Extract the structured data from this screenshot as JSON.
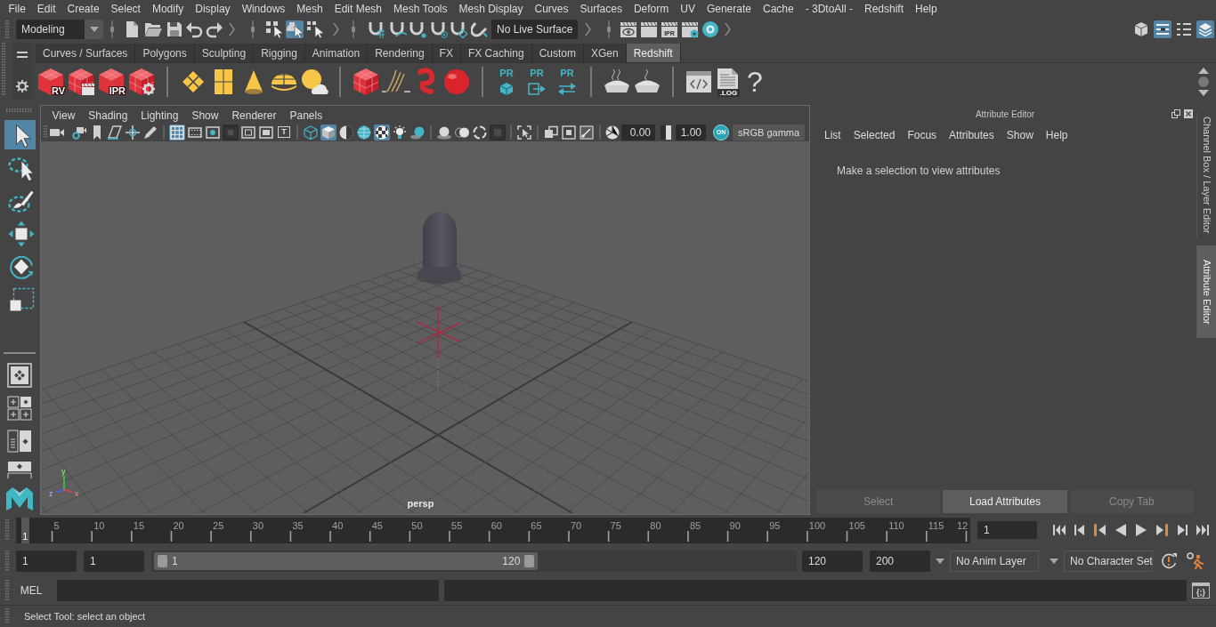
{
  "menu_bar": [
    "File",
    "Edit",
    "Create",
    "Select",
    "Modify",
    "Display",
    "Windows",
    "Mesh",
    "Edit Mesh",
    "Mesh Tools",
    "Mesh Display",
    "Curves",
    "Surfaces",
    "Deform",
    "UV",
    "Generate",
    "Cache",
    "- 3DtoAll -",
    "Redshift",
    "Help"
  ],
  "status_line": {
    "menu_set": "Modeling",
    "selection_modes": [
      {
        "selected": false
      },
      {
        "selected": true
      },
      {
        "selected": false
      }
    ],
    "live_surface": "No Live Surface",
    "ipr_label": "IPR",
    "panel_toggles": [
      {
        "on": false
      },
      {
        "on": true
      },
      {
        "on": false
      },
      {
        "on": true
      }
    ]
  },
  "shelf": {
    "tabs": [
      {
        "label": "Curves / Surfaces",
        "selected": false
      },
      {
        "label": "Polygons",
        "selected": false
      },
      {
        "label": "Sculpting",
        "selected": false
      },
      {
        "label": "Rigging",
        "selected": false
      },
      {
        "label": "Animation",
        "selected": false
      },
      {
        "label": "Rendering",
        "selected": false
      },
      {
        "label": "FX",
        "selected": false
      },
      {
        "label": "FX Caching",
        "selected": false
      },
      {
        "label": "Custom",
        "selected": false
      },
      {
        "label": "XGen",
        "selected": false
      },
      {
        "label": "Redshift",
        "selected": true
      }
    ],
    "render_view_label": "RV",
    "ipr_label": "IPR",
    "pr_labels": [
      "PR",
      "PR",
      "PR"
    ],
    "log_label": ".LOG",
    "help_label": "?"
  },
  "tool_box": {
    "tools": [
      {
        "selected": true
      },
      {
        "selected": false
      },
      {
        "selected": false
      },
      {
        "selected": false
      },
      {
        "selected": false
      },
      {
        "selected": false
      }
    ]
  },
  "viewport": {
    "menu": [
      "View",
      "Shading",
      "Lighting",
      "Show",
      "Renderer",
      "Panels"
    ],
    "toolbar": [
      {
        "on": false,
        "disabled": false
      },
      {
        "on": false,
        "disabled": false
      },
      {
        "on": false,
        "disabled": false
      },
      {
        "on": false,
        "disabled": false
      },
      {
        "on": false,
        "disabled": false
      },
      {
        "on": false,
        "disabled": false
      },
      {
        "on": true,
        "disabled": false
      },
      {
        "on": false,
        "disabled": false
      },
      {
        "on": false,
        "disabled": false
      },
      {
        "on": false,
        "disabled": true
      },
      {
        "on": false,
        "disabled": false
      },
      {
        "on": false,
        "disabled": false
      },
      {
        "on": false,
        "disabled": false
      },
      {
        "on": false,
        "disabled": false
      },
      {
        "on": true,
        "disabled": false
      },
      {
        "on": false,
        "disabled": false
      },
      {
        "on": false,
        "disabled": false
      },
      {
        "on": true,
        "disabled": false
      },
      {
        "on": false,
        "disabled": false
      },
      {
        "on": false,
        "disabled": false
      },
      {
        "on": false,
        "disabled": false
      },
      {
        "on": false,
        "disabled": false
      },
      {
        "on": false,
        "disabled": false
      },
      {
        "on": false,
        "disabled": true
      },
      {
        "on": false,
        "disabled": false
      },
      {
        "on": false,
        "disabled": false
      },
      {
        "on": false,
        "disabled": false
      },
      {
        "on": false,
        "disabled": false
      }
    ],
    "safe_title_label": "T",
    "exposure": "0.00",
    "gamma": "1.00",
    "color_management": {
      "label": "ON",
      "on": true
    },
    "view_transform": "sRGB gamma",
    "axis_labels": [
      "x",
      "y",
      "z"
    ],
    "camera": "persp"
  },
  "attribute_editor": {
    "title": "Attribute Editor",
    "menu": [
      "List",
      "Selected",
      "Focus",
      "Attributes",
      "Show",
      "Help"
    ],
    "message": "Make a selection to view attributes",
    "buttons": [
      {
        "label": "Select",
        "disabled": true
      },
      {
        "label": "Load Attributes",
        "disabled": false
      },
      {
        "label": "Copy Tab",
        "disabled": true
      }
    ]
  },
  "side_tabs": [
    {
      "label": "Channel Box / Layer Editor",
      "selected": false
    },
    {
      "label": "Attribute Editor",
      "selected": true
    }
  ],
  "time_slider": {
    "ticks": [
      "5",
      "10",
      "15",
      "20",
      "25",
      "30",
      "35",
      "40",
      "45",
      "50",
      "55",
      "60",
      "65",
      "70",
      "75",
      "80",
      "85",
      "90",
      "95",
      "100",
      "105",
      "110",
      "115",
      "12"
    ],
    "current_frame_marker": "1",
    "level": 0,
    "current_frame": "1"
  },
  "range_slider": {
    "start": "1",
    "playback_start": "1",
    "range_start": "1",
    "range_end": "120",
    "level": 0.6,
    "playback_end": "120",
    "end": "200",
    "anim_layer": "No Anim Layer",
    "character_set": "No Character Set"
  },
  "command_line": {
    "language": "MEL",
    "script_editor_label": "{;}"
  },
  "help_line": "Select Tool: select an object"
}
